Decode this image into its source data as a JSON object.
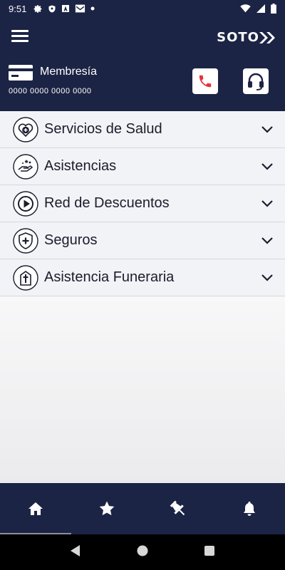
{
  "status_bar": {
    "time": "9:51",
    "icons": [
      "gear-icon",
      "shield-icon",
      "a-icon",
      "mail-icon",
      "dot-icon"
    ],
    "right_icons": [
      "wifi-icon",
      "signal-icon",
      "battery-icon"
    ]
  },
  "header": {
    "logo_text": "SOTO",
    "membership_label": "Membresía",
    "card_number": "0000 0000 0000 0000",
    "phone_icon": "phone-icon",
    "support_icon": "headset-icon"
  },
  "colors": {
    "navy": "#1c2445",
    "phone_red": "#e8323a",
    "item_bg": "#f2f3f7"
  },
  "services": [
    {
      "label": "Servicios de Salud",
      "icon": "heart-plus-icon"
    },
    {
      "label": "Asistencias",
      "icon": "hand-assist-icon"
    },
    {
      "label": "Red de Descuentos",
      "icon": "play-icon"
    },
    {
      "label": "Seguros",
      "icon": "shield-plus-icon"
    },
    {
      "label": "Asistencia Funeraria",
      "icon": "cross-icon"
    }
  ],
  "bottom_nav": [
    {
      "icon": "home-icon",
      "active": true
    },
    {
      "icon": "star-icon",
      "active": false
    },
    {
      "icon": "pin-icon",
      "active": false
    },
    {
      "icon": "bell-icon",
      "active": false
    }
  ],
  "system_nav": [
    "back-icon",
    "home-circle-icon",
    "recents-icon"
  ]
}
